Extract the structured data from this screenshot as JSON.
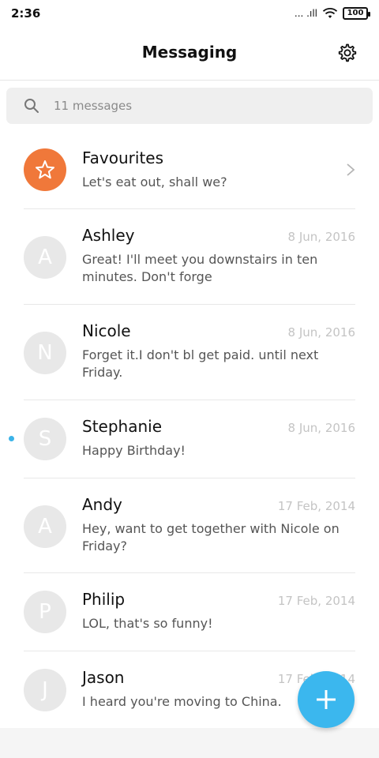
{
  "status_bar": {
    "time": "2:36",
    "signal_text": "... .ıll",
    "battery": "100"
  },
  "header": {
    "title": "Messaging"
  },
  "search": {
    "placeholder": "11 messages"
  },
  "conversations": [
    {
      "initial": "",
      "name": "Favourites",
      "date": "",
      "preview": "Let's eat out, shall we?",
      "favourite": true
    },
    {
      "initial": "A",
      "name": "Ashley",
      "date": "8 Jun, 2016",
      "preview": "Great! I'll meet you downstairs in ten minutes. Don't forge"
    },
    {
      "initial": "N",
      "name": "Nicole",
      "date": "8 Jun, 2016",
      "preview": "Forget it.I don't bl get paid. until next Friday."
    },
    {
      "initial": "S",
      "name": "Stephanie",
      "date": "8 Jun, 2016",
      "preview": "Happy Birthday!",
      "unread": true
    },
    {
      "initial": "A",
      "name": "Andy",
      "date": "17 Feb, 2014",
      "preview": "Hey, want to get together with Nicole on Friday?"
    },
    {
      "initial": "P",
      "name": "Philip",
      "date": "17 Feb, 2014",
      "preview": "LOL, that's so funny!"
    },
    {
      "initial": "J",
      "name": "Jason",
      "date": "17 Feb, 2014",
      "preview": "I heard you're moving to China."
    }
  ],
  "colors": {
    "accent": "#3bb7ee",
    "favourite": "#f0783a",
    "unread": "#3bb3e8"
  },
  "icons": {
    "settings": "gear-icon",
    "search": "search-icon",
    "favourite": "star-icon",
    "open": "chevron-right-icon",
    "compose": "plus-icon"
  }
}
